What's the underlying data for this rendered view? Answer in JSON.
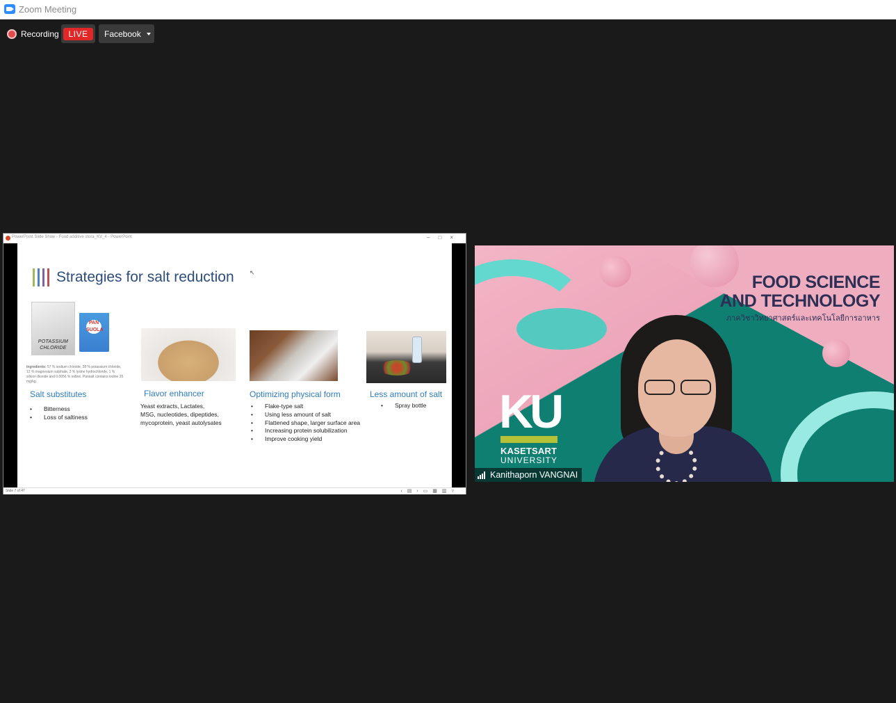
{
  "window": {
    "title": "Zoom Meeting"
  },
  "recording": {
    "label": "Recording",
    "live_label": "LIVE",
    "platform": "Facebook"
  },
  "powerpoint": {
    "window_title": "PowerPoint Slide Show  -  Food additive stora_KV_4  -  PowerPoint",
    "status_slide": "Slide 7 of 47"
  },
  "slide": {
    "title": "Strategies for salt reduction",
    "title_bar_colors": [
      "#9bbb59",
      "#4f81bd",
      "#8064a2",
      "#c0504d"
    ],
    "kcl_label": "POTASSIUM CHLORIDE",
    "pan_label": "PAN SUOLA",
    "ingredients_label": "Ingredients:",
    "ingredients_text": "57 % sodium chloride, 28 % potassium chloride, 12 % magnesium sulphate, 2 % lysine hydrochloride, 1 % silicon dioxide and 0.0056 % iodine. Pansalt contains iodine 25 mg/kg.",
    "columns": [
      {
        "heading": "Salt substitutes",
        "items": [
          "Bitterness",
          "Loss of saltiness"
        ]
      },
      {
        "heading": "Flavor enhancer",
        "lines": [
          "Yeast extracts, Lactates,",
          "MSG, nucleotides, dipeptides,",
          "mycoprotein, yeast autolysates"
        ]
      },
      {
        "heading": "Optimizing physical form",
        "items": [
          "Flake-type salt",
          "Using less amount of salt",
          "Flattened shape, larger surface area",
          "Increasing protein solubilization",
          "Improve cooking yield"
        ]
      },
      {
        "heading": "Less amount of salt",
        "items": [
          "Spray bottle"
        ]
      }
    ]
  },
  "participant": {
    "name": "Kanithaporn VANGNAI",
    "bg_title_line1": "FOOD SCIENCE",
    "bg_title_line2": "AND TECHNOLOGY",
    "bg_subtitle": "ภาควิชาวิทยาศาสตร์และเทคโนโลยีการอาหาร",
    "logo": "KU",
    "uni_line1": "KASETSART",
    "uni_line2": "UNIVERSITY"
  },
  "colors": {
    "live_red": "#e02828",
    "slide_heading_blue": "#2e7bbf",
    "slide_title_navy": "#2d4d7c"
  }
}
